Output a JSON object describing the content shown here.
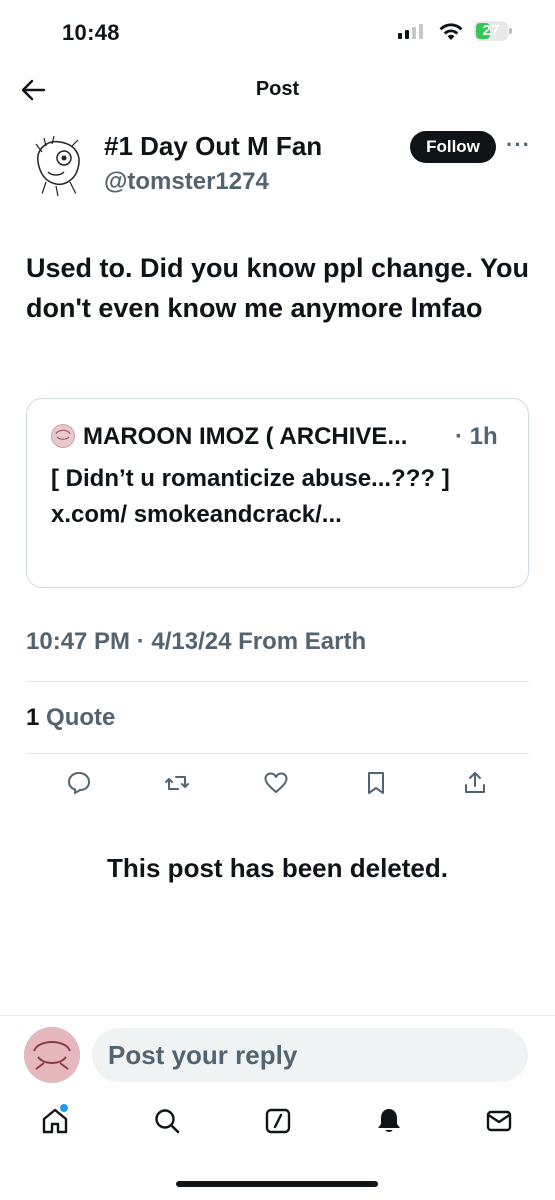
{
  "status_bar": {
    "time": "10:48",
    "battery": "27"
  },
  "header": {
    "title": "Post"
  },
  "author": {
    "display_name": "#1 Day Out M Fan",
    "handle": "@tomster1274",
    "follow_label": "Follow",
    "more": "···"
  },
  "post": {
    "text": "Used to. Did you know ppl change. You don't even know me anymore lmfao",
    "timestamp": "10:47 PM · 4/13/24 From Earth",
    "quote_count": "1",
    "quote_label": "Quote"
  },
  "quoted_post": {
    "author": "MAROON IMOZ ( ARCHIVE...",
    "time": "· 1h",
    "text": "[ Didn’t u romanticize abuse...??? ] x.com/ smokeandcrack/..."
  },
  "notice": {
    "deleted": "This post has been deleted."
  },
  "reply": {
    "placeholder": "Post your reply"
  },
  "icons": {
    "back": "arrow-left-icon",
    "reply": "reply-icon",
    "repost": "repost-icon",
    "like": "heart-icon",
    "bookmark": "bookmark-icon",
    "share": "share-icon",
    "home": "home-icon",
    "search": "search-icon",
    "grok": "grok-icon",
    "notifications": "bell-icon",
    "messages": "mail-icon"
  },
  "colors": {
    "text": "#0f1419",
    "secondary": "#536471",
    "accent": "#1d9bf0",
    "battery": "#34c759"
  }
}
